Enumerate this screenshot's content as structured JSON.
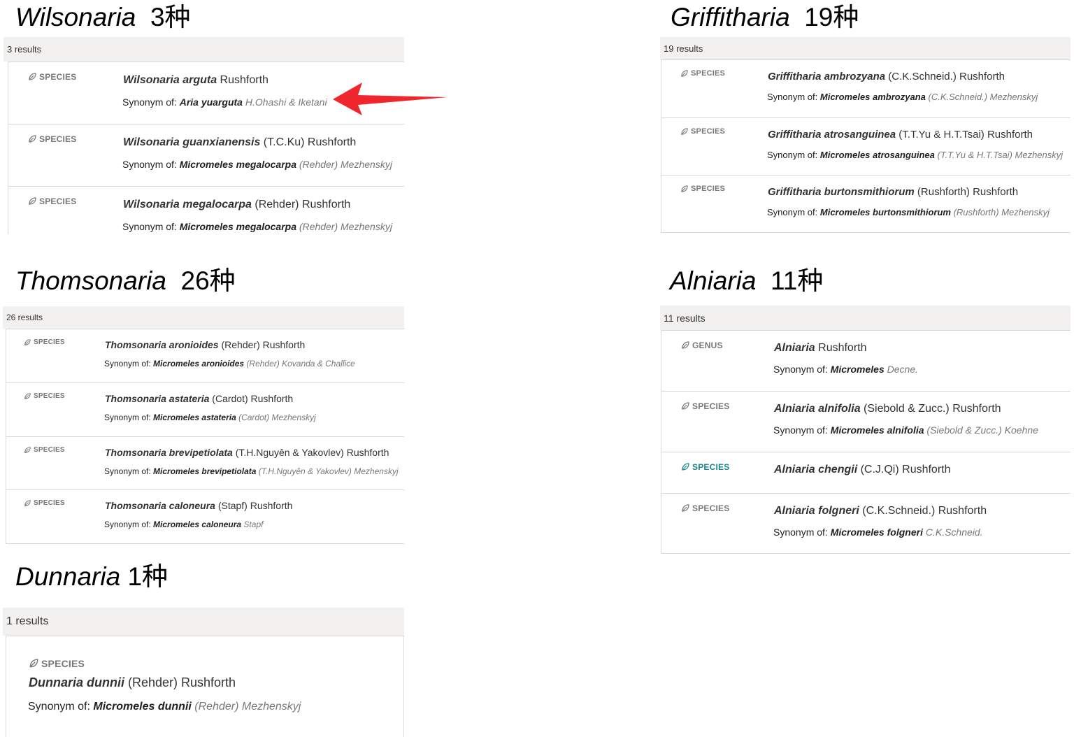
{
  "colors": {
    "accent_teal": "#17858f",
    "arrow_red": "#f0262d",
    "bar_bg": "#f2f1ef",
    "border": "#d8d8d8"
  },
  "icons": {
    "badge_icon": "leaf-icon",
    "annotation": "red-arrow"
  },
  "panels": {
    "wilsonaria": {
      "genus": "Wilsonaria",
      "count": "3种",
      "results": "3 results",
      "rows": [
        {
          "type": "SPECIES",
          "name": "Wilsonaria arguta",
          "author": " Rushforth",
          "synonym_label": "Synonym of: ",
          "synonym_name": "Aria yuarguta",
          "synonym_author": " H.Ohashi & Iketani"
        },
        {
          "type": "SPECIES",
          "name": "Wilsonaria guanxianensis",
          "author": " (T.C.Ku) Rushforth",
          "synonym_label": "Synonym of: ",
          "synonym_name": "Micromeles megalocarpa",
          "synonym_author": " (Rehder) Mezhenskyj"
        },
        {
          "type": "SPECIES",
          "name": "Wilsonaria megalocarpa",
          "author": " (Rehder) Rushforth",
          "synonym_label": "Synonym of: ",
          "synonym_name": "Micromeles megalocarpa",
          "synonym_author": " (Rehder) Mezhenskyj"
        }
      ]
    },
    "griffitharia": {
      "genus": "Griffitharia",
      "count": "19种",
      "results": "19 results",
      "rows": [
        {
          "type": "SPECIES",
          "name": "Griffitharia ambrozyana",
          "author": " (C.K.Schneid.) Rushforth",
          "synonym_label": "Synonym of: ",
          "synonym_name": "Micromeles ambrozyana",
          "synonym_author": " (C.K.Schneid.) Mezhenskyj"
        },
        {
          "type": "SPECIES",
          "name": "Griffitharia atrosanguinea",
          "author": " (T.T.Yu & H.T.Tsai) Rushforth",
          "synonym_label": "Synonym of: ",
          "synonym_name": "Micromeles atrosanguinea",
          "synonym_author": " (T.T.Yu & H.T.Tsai) Mezhenskyj"
        },
        {
          "type": "SPECIES",
          "name": "Griffitharia burtonsmithiorum",
          "author": " (Rushforth) Rushforth",
          "synonym_label": "Synonym of: ",
          "synonym_name": "Micromeles burtonsmithiorum",
          "synonym_author": " (Rushforth) Mezhenskyj"
        }
      ]
    },
    "thomsonaria": {
      "genus": "Thomsonaria",
      "count": "26种",
      "results": "26 results",
      "rows": [
        {
          "type": "SPECIES",
          "name": "Thomsonaria aronioides",
          "author": " (Rehder) Rushforth",
          "synonym_label": "Synonym of: ",
          "synonym_name": "Micromeles aronioides",
          "synonym_author": " (Rehder) Kovanda & Challice"
        },
        {
          "type": "SPECIES",
          "name": "Thomsonaria astateria",
          "author": " (Cardot) Rushforth",
          "synonym_label": "Synonym of: ",
          "synonym_name": "Micromeles astateria",
          "synonym_author": " (Cardot) Mezhenskyj"
        },
        {
          "type": "SPECIES",
          "name": "Thomsonaria brevipetiolata",
          "author": " (T.H.Nguyên & Yakovlev) Rushforth",
          "synonym_label": "Synonym of: ",
          "synonym_name": "Micromeles brevipetiolata",
          "synonym_author": " (T.H.Nguyên & Yakovlev) Mezhenskyj"
        },
        {
          "type": "SPECIES",
          "name": "Thomsonaria caloneura",
          "author": " (Stapf) Rushforth",
          "synonym_label": "Synonym of: ",
          "synonym_name": "Micromeles caloneura",
          "synonym_author": " Stapf"
        }
      ]
    },
    "alniaria": {
      "genus": "Alniaria",
      "count": "11种",
      "results": "11 results",
      "rows": [
        {
          "type": "GENUS",
          "name": "Alniaria",
          "author": " Rushforth",
          "synonym_label": "Synonym of: ",
          "synonym_name": "Micromeles",
          "synonym_author": " Decne."
        },
        {
          "type": "SPECIES",
          "name": "Alniaria alnifolia",
          "author": " (Siebold & Zucc.) Rushforth",
          "synonym_label": "Synonym of: ",
          "synonym_name": "Micromeles alnifolia",
          "synonym_author": " (Siebold & Zucc.) Koehne"
        },
        {
          "type": "SPECIES",
          "name": "Alniaria chengii",
          "author": " (C.J.Qi) Rushforth",
          "synonym_label": "",
          "synonym_name": "",
          "synonym_author": ""
        },
        {
          "type": "SPECIES",
          "name": "Alniaria folgneri",
          "author": " (C.K.Schneid.) Rushforth",
          "synonym_label": "Synonym of: ",
          "synonym_name": "Micromeles folgneri",
          "synonym_author": " C.K.Schneid."
        }
      ]
    },
    "dunnaria": {
      "genus": "Dunnaria",
      "count": "1种",
      "results": "1 results",
      "rows": [
        {
          "type": "SPECIES",
          "name": "Dunnaria dunnii",
          "author": " (Rehder) Rushforth",
          "synonym_label": "Synonym of: ",
          "synonym_name": "Micromeles dunnii",
          "synonym_author": " (Rehder) Mezhenskyj"
        }
      ]
    }
  }
}
